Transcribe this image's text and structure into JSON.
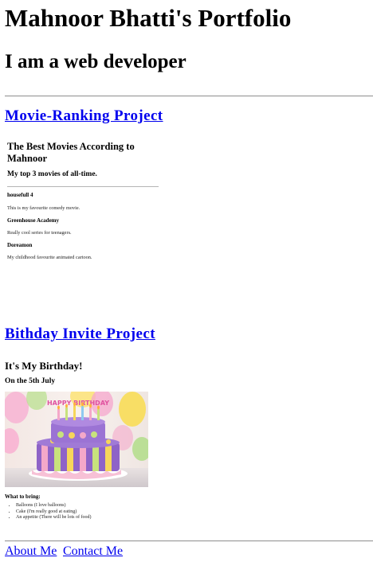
{
  "header": {
    "title": "Mahnoor Bhatti's Portfolio",
    "subtitle": "I am a web developer"
  },
  "projects": [
    {
      "link_label": "Movie-Ranking Project",
      "preview": {
        "title": "The Best Movies According to Mahnoor",
        "subtitle": "My top 3 movies of all-time.",
        "movies": [
          {
            "name": "housefull 4",
            "description": "This is my favourite comedy movie."
          },
          {
            "name": "Greenhouse Academy",
            "description": "Really cool series for teenagers."
          },
          {
            "name": "Doreamon",
            "description": "My childhood favourite animated cartoon."
          }
        ]
      }
    },
    {
      "link_label": "Bithday Invite Project",
      "preview": {
        "title": "It's My Birthday!",
        "date": "On the 5th July",
        "image_text": "HAPPY BIRTHDAY",
        "bring_label": "What to bring:",
        "bring_items": [
          "Balloons (I love balloons)",
          "Cake (I'm really good at eating)",
          "An appetite (There will be lots of food)"
        ]
      }
    }
  ],
  "footer": {
    "about_label": "About Me",
    "contact_label": "Contact Me"
  },
  "colors": {
    "link": "#0000ee",
    "rule": "#9a9a9a"
  }
}
